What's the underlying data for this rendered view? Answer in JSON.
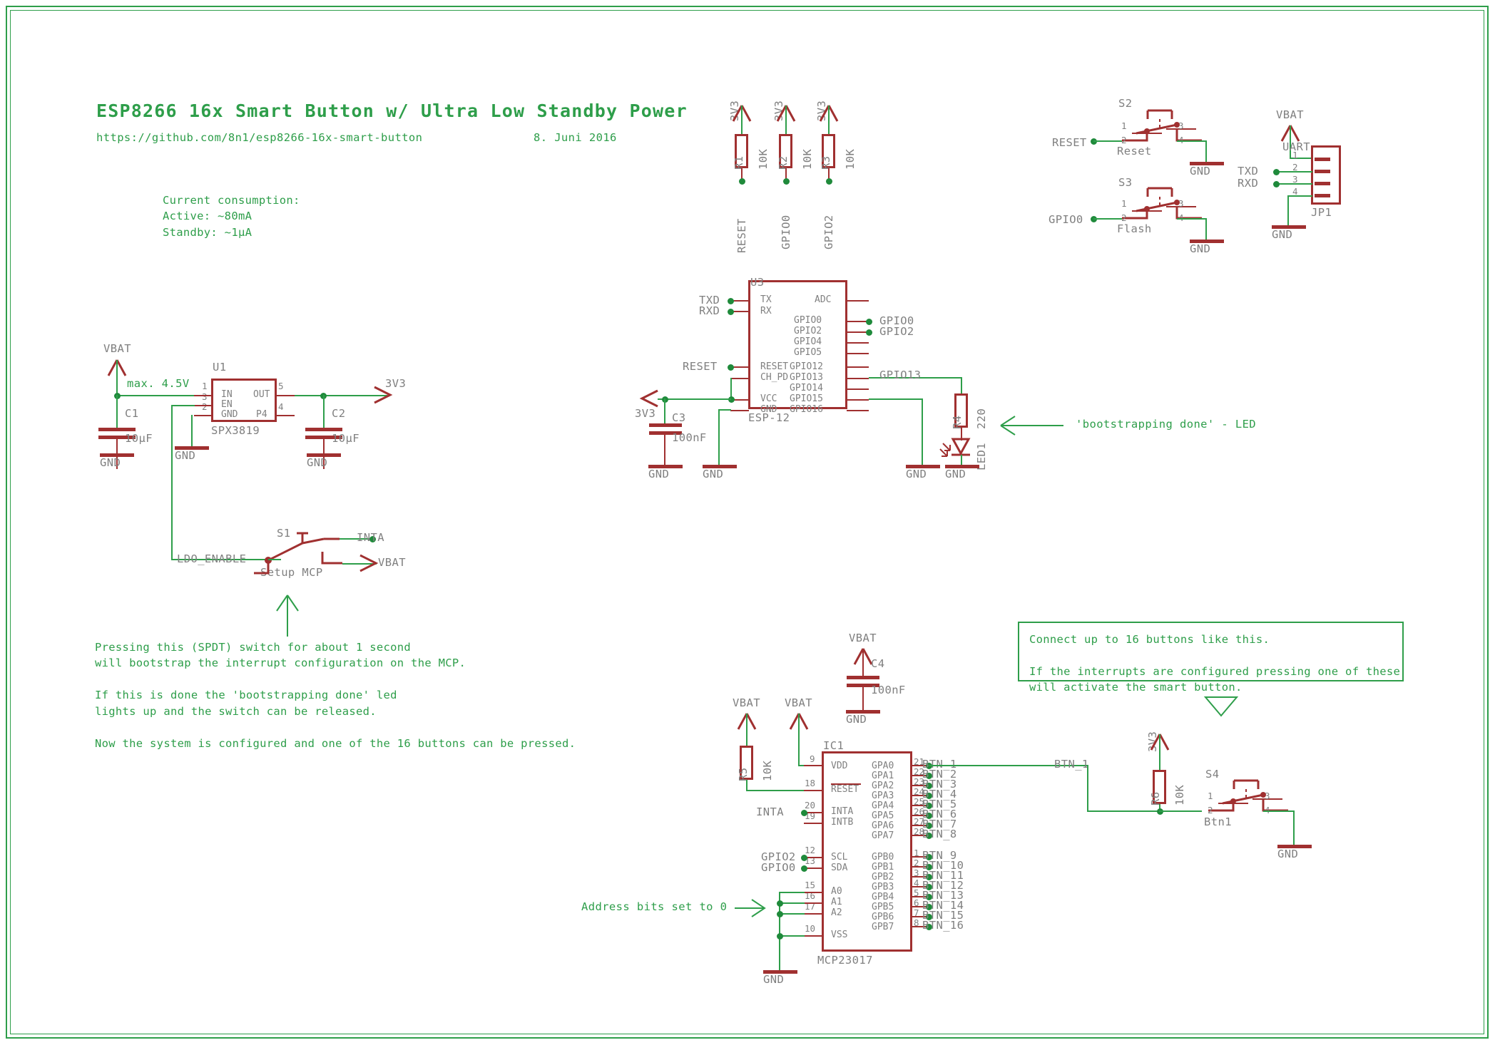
{
  "sheet": {
    "title": "ESP8266 16x Smart Button w/ Ultra Low Standby Power",
    "url": "https://github.com/8n1/esp8266-16x-smart-button",
    "date": "8. Juni 2016",
    "consumption": "Current consumption:\nActive: ~80mA\nStandby: ~1µA"
  },
  "notes": {
    "max_input": "max. 4.5V",
    "led_note": "'bootstrapping done' - LED",
    "address_note": "Address bits set to 0",
    "switch_note": "Pressing this (SPDT) switch for about 1 second\nwill bootstrap the interrupt configuration on the MCP.\n\nIf this is done the 'bootstrapping done' led\nlights up and the switch can be released.\n\nNow the system is configured and one of the 16 buttons can be pressed.",
    "buttons_note": "Connect up to 16 buttons like this.\n\nIf the interrupts are configured pressing one of these\nwill activate the smart button."
  },
  "nets": {
    "vbat": "VBAT",
    "gnd": "GND",
    "v3v3": "3V3",
    "reset": "RESET",
    "gpio0": "GPIO0",
    "gpio2": "GPIO2",
    "gpio13": "GPIO13",
    "txd": "TXD",
    "rxd": "RXD",
    "inta": "INTA",
    "ldo_enable": "LDO_ENABLE",
    "btn1": "BTN_1"
  },
  "regulator": {
    "ref": "U1",
    "value": "SPX3819",
    "pins_left": [
      {
        "num": "1",
        "name": "IN"
      },
      {
        "num": "3",
        "name": "EN"
      },
      {
        "num": "2",
        "name": "GND"
      }
    ],
    "pins_right": [
      {
        "num": "5",
        "name": "OUT"
      },
      {
        "num": "4",
        "name": "P4"
      }
    ]
  },
  "caps": [
    {
      "ref": "C1",
      "value": "10µF"
    },
    {
      "ref": "C2",
      "value": "10µF"
    },
    {
      "ref": "C3",
      "value": "100nF"
    },
    {
      "ref": "C4",
      "value": "100nF"
    }
  ],
  "resistors": [
    {
      "ref": "R1",
      "value": "10K",
      "net": "RESET"
    },
    {
      "ref": "R2",
      "value": "10K",
      "net": "GPIO0"
    },
    {
      "ref": "R3",
      "value": "10K",
      "net": "GPIO2"
    },
    {
      "ref": "R4",
      "value": "220"
    },
    {
      "ref": "R5",
      "value": "10K"
    },
    {
      "ref": "R6",
      "value": "10K"
    }
  ],
  "led": {
    "ref": "LED1"
  },
  "switches": [
    {
      "ref": "S1",
      "name": "Setup MCP"
    },
    {
      "ref": "S2",
      "name": "Reset"
    },
    {
      "ref": "S3",
      "name": "Flash"
    },
    {
      "ref": "S4",
      "name": "Btn1"
    }
  ],
  "switch_pins": [
    "1",
    "2",
    "3",
    "4"
  ],
  "esp": {
    "ref": "U3",
    "value": "ESP-12",
    "pins_left": [
      "TX",
      "RX",
      "RESET",
      "CH_PD",
      "VCC",
      "GND"
    ],
    "pins_right": [
      "ADC",
      "GPIO0",
      "GPIO2",
      "GPIO4",
      "GPIO5",
      "GPIO12",
      "GPIO13",
      "GPIO14",
      "GPIO15",
      "GPIO16"
    ]
  },
  "uart": {
    "ref": "JP1",
    "name": "UART",
    "pins": [
      {
        "num": "1",
        "net": "VBAT"
      },
      {
        "num": "2",
        "net": "TXD"
      },
      {
        "num": "3",
        "net": "RXD"
      },
      {
        "num": "4",
        "net": "GND"
      }
    ]
  },
  "mcp": {
    "ref": "IC1",
    "value": "MCP23017",
    "pins_left": [
      {
        "num": "9",
        "name": "VDD"
      },
      {
        "num": "18",
        "name": "RESET"
      },
      {
        "num": "20",
        "name": "INTA"
      },
      {
        "num": "19",
        "name": "INTB"
      },
      {
        "num": "12",
        "name": "SCL"
      },
      {
        "num": "13",
        "name": "SDA"
      },
      {
        "num": "15",
        "name": "A0"
      },
      {
        "num": "16",
        "name": "A1"
      },
      {
        "num": "17",
        "name": "A2"
      },
      {
        "num": "10",
        "name": "VSS"
      }
    ],
    "pins_right": [
      {
        "num": "21",
        "name": "GPA0",
        "net": "BTN_1"
      },
      {
        "num": "22",
        "name": "GPA1",
        "net": "BTN_2"
      },
      {
        "num": "23",
        "name": "GPA2",
        "net": "BTN_3"
      },
      {
        "num": "24",
        "name": "GPA3",
        "net": "BTN_4"
      },
      {
        "num": "25",
        "name": "GPA4",
        "net": "BTN_5"
      },
      {
        "num": "26",
        "name": "GPA5",
        "net": "BTN_6"
      },
      {
        "num": "27",
        "name": "GPA6",
        "net": "BTN_7"
      },
      {
        "num": "28",
        "name": "GPA7",
        "net": "BTN_8"
      },
      {
        "num": "1",
        "name": "GPB0",
        "net": "BTN_9"
      },
      {
        "num": "2",
        "name": "GPB1",
        "net": "BTN_10"
      },
      {
        "num": "3",
        "name": "GPB2",
        "net": "BTN_11"
      },
      {
        "num": "4",
        "name": "GPB3",
        "net": "BTN_12"
      },
      {
        "num": "5",
        "name": "GPB4",
        "net": "BTN_13"
      },
      {
        "num": "6",
        "name": "GPB5",
        "net": "BTN_14"
      },
      {
        "num": "7",
        "name": "GPB6",
        "net": "BTN_15"
      },
      {
        "num": "8",
        "name": "GPB7",
        "net": "BTN_16"
      }
    ]
  },
  "colors": {
    "wire": "#2e9e4a",
    "symbol": "#a03030",
    "label": "#808080"
  }
}
